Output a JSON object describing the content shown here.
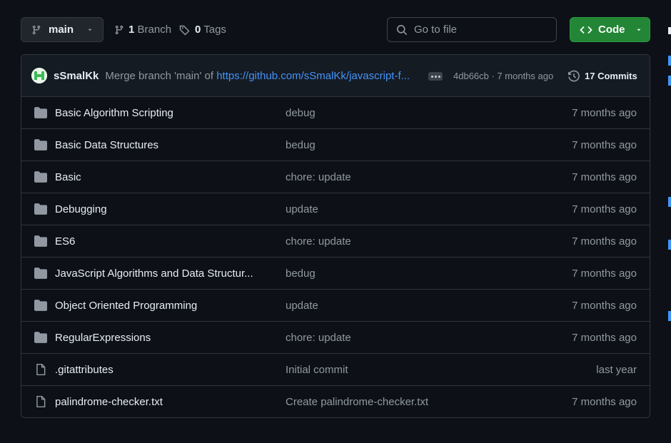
{
  "toolbar": {
    "branch_label": "main",
    "branches_count": "1",
    "branches_label": "Branch",
    "tags_count": "0",
    "tags_label": "Tags",
    "search_placeholder": "Go to file",
    "code_label": "Code"
  },
  "commit": {
    "author": "sSmalKk",
    "message_prefix": "Merge branch 'main' of ",
    "message_link": "https://github.com/sSmalKk/javascript-f...",
    "hash_and_age": "4db66cb · 7 months ago",
    "commits_label": "17 Commits"
  },
  "files": [
    {
      "type": "folder",
      "name": "Basic Algorithm Scripting",
      "message": "debug",
      "age": "7 months ago"
    },
    {
      "type": "folder",
      "name": "Basic Data Structures",
      "message": "bedug",
      "age": "7 months ago"
    },
    {
      "type": "folder",
      "name": "Basic",
      "message": "chore: update",
      "age": "7 months ago"
    },
    {
      "type": "folder",
      "name": "Debugging",
      "message": "update",
      "age": "7 months ago"
    },
    {
      "type": "folder",
      "name": "ES6",
      "message": "chore: update",
      "age": "7 months ago"
    },
    {
      "type": "folder",
      "name": "JavaScript Algorithms and Data Structur...",
      "message": "bedug",
      "age": "7 months ago"
    },
    {
      "type": "folder",
      "name": "Object Oriented Programming",
      "message": "update",
      "age": "7 months ago"
    },
    {
      "type": "folder",
      "name": "RegularExpressions",
      "message": "chore: update",
      "age": "7 months ago"
    },
    {
      "type": "file",
      "name": ".gitattributes",
      "message": "Initial commit",
      "age": "last year"
    },
    {
      "type": "file",
      "name": "palindrome-checker.txt",
      "message": "Create palindrome-checker.txt",
      "age": "7 months ago"
    }
  ],
  "colors": {
    "background": "#0d1117",
    "accent_green": "#238636",
    "link_blue": "#4493f8",
    "muted_text": "#9198a1"
  },
  "icons": {
    "branch": "git-branch-icon",
    "tag": "tag-icon",
    "search": "search-icon",
    "code": "code-icon",
    "history": "history-icon",
    "folder": "folder-icon",
    "file": "file-icon"
  }
}
